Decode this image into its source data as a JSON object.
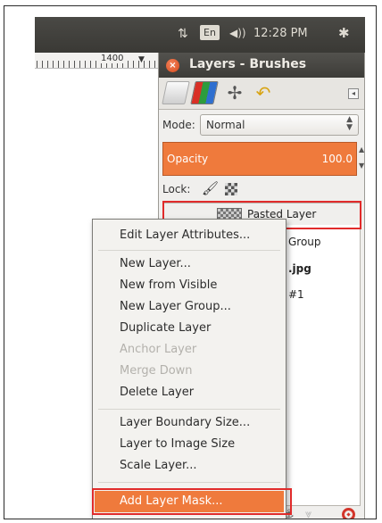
{
  "panel": {
    "sort_glyph": "⇅",
    "language": "En",
    "volume_glyph": "◀))",
    "clock": "12:28 PM",
    "gear_glyph": "✱"
  },
  "ruler": {
    "mark": "1400"
  },
  "dock": {
    "title": "Layers - Brushes",
    "mode_label": "Mode:",
    "mode_value": "Normal",
    "opacity_label": "Opacity",
    "opacity_value": "100.0",
    "lock_label": "Lock:",
    "layers": [
      {
        "name": "Pasted Layer"
      }
    ],
    "partial_rows": [
      "Group",
      ".jpg",
      "#1"
    ]
  },
  "context_menu": {
    "items": [
      {
        "label": "Edit Layer Attributes...",
        "disabled": false
      },
      {
        "label": "New Layer...",
        "disabled": false
      },
      {
        "label": "New from Visible",
        "disabled": false
      },
      {
        "label": "New Layer Group...",
        "disabled": false
      },
      {
        "label": "Duplicate Layer",
        "disabled": false
      },
      {
        "label": "Anchor Layer",
        "disabled": true
      },
      {
        "label": "Merge Down",
        "disabled": true
      },
      {
        "label": "Delete Layer",
        "disabled": false
      },
      {
        "label": "Layer Boundary Size...",
        "disabled": false
      },
      {
        "label": "Layer to Image Size",
        "disabled": false
      },
      {
        "label": "Scale Layer...",
        "disabled": false
      },
      {
        "label": "Add Layer Mask...",
        "disabled": false,
        "highlighted": true
      }
    ]
  },
  "colors": {
    "accent": "#ef7a3c",
    "highlight_box": "#e12b2b",
    "panel_bg": "#3c3b37"
  }
}
